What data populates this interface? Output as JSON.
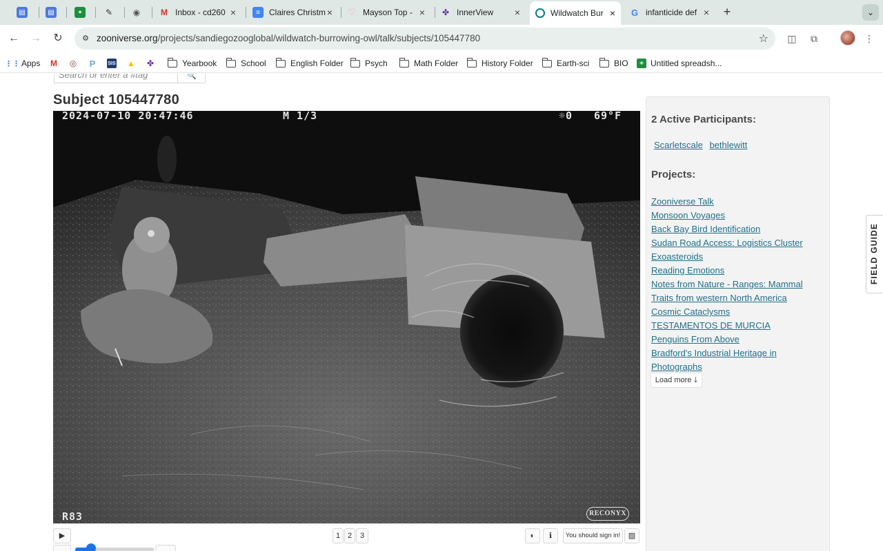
{
  "tabs": [
    {
      "title": "",
      "icon": "printer-icon",
      "color": "#4f7bd9"
    },
    {
      "title": "",
      "icon": "printer-icon",
      "color": "#4f7bd9"
    },
    {
      "title": "",
      "icon": "sheets-icon",
      "color": "#1e8e3e"
    },
    {
      "title": "",
      "icon": "signature-icon",
      "color": "#333333"
    },
    {
      "title": "",
      "icon": "owl-icon",
      "color": "#555555"
    },
    {
      "title": "Inbox - cd260",
      "icon": "gmail-icon",
      "color": "#d93025"
    },
    {
      "title": "Claires Christm",
      "icon": "docs-icon",
      "color": "#4285f4"
    },
    {
      "title": "Mayson Top -",
      "icon": "heart-icon",
      "color": "#e8a0a0"
    },
    {
      "title": "InnerView",
      "icon": "innerview-icon",
      "color": "#6b2fa0"
    },
    {
      "title": "Wildwatch Bur",
      "icon": "zooniverse-icon",
      "color": "#0a7b8c"
    },
    {
      "title": "infanticide def",
      "icon": "google-icon",
      "color": "#4285f4"
    }
  ],
  "address_bar": {
    "domain": "zooniverse.org",
    "path": "/projects/sandiegozooglobal/wildwatch-burrowing-owl/talk/subjects/105447780"
  },
  "bookmarks": [
    {
      "label": "Apps",
      "icon": "apps-grid-icon"
    },
    {
      "label": "",
      "icon": "gmail-icon"
    },
    {
      "label": "",
      "icon": "seal-icon"
    },
    {
      "label": "",
      "icon": "p-icon"
    },
    {
      "label": "",
      "icon": "sis-icon",
      "text": "SIS"
    },
    {
      "label": "",
      "icon": "drive-icon"
    },
    {
      "label": "",
      "icon": "innerview-icon"
    },
    {
      "label": "Yearbook",
      "icon": "folder-icon"
    },
    {
      "label": "School",
      "icon": "folder-icon"
    },
    {
      "label": "English Folder",
      "icon": "folder-icon"
    },
    {
      "label": "Psych",
      "icon": "folder-icon"
    },
    {
      "label": "Math Folder",
      "icon": "folder-icon"
    },
    {
      "label": "History Folder",
      "icon": "folder-icon"
    },
    {
      "label": "Earth-sci",
      "icon": "folder-icon"
    },
    {
      "label": "BIO",
      "icon": "folder-icon"
    },
    {
      "label": "Untitled spreadsh...",
      "icon": "sheets-icon"
    }
  ],
  "search": {
    "placeholder": "Search or enter a #tag"
  },
  "subject": {
    "title": "Subject 105447780",
    "camera_overlay": {
      "timestamp": "2024-07-10  20:47:46",
      "frame": "M 1/3",
      "temperature_symbol": "☼0",
      "temperature": "69°F",
      "camera_id": "R83",
      "brand": "RECONYX"
    },
    "frames": [
      "1",
      "2",
      "3"
    ],
    "sign_in_notice": "You should sign in!",
    "slider_position": 0.2
  },
  "sidebar": {
    "participants_heading": "2 Active Participants:",
    "participants": [
      "Scarletscale",
      "bethlewitt"
    ],
    "projects_heading": "Projects:",
    "projects": [
      "Zooniverse Talk",
      "Monsoon Voyages",
      "Back Bay Bird Identification",
      "Sudan Road Access: Logistics Cluster",
      "Exoasteroids",
      "Reading Emotions",
      "Notes from Nature - Ranges: Mammal ",
      "Traits from western North America",
      "Cosmic Cataclysms ",
      "TESTAMENTOS DE MURCIA",
      "Penguins From Above",
      "Bradford's Industrial Heritage in ",
      "Photographs"
    ],
    "load_more": "Load more"
  },
  "field_guide": "FIELD GUIDE"
}
